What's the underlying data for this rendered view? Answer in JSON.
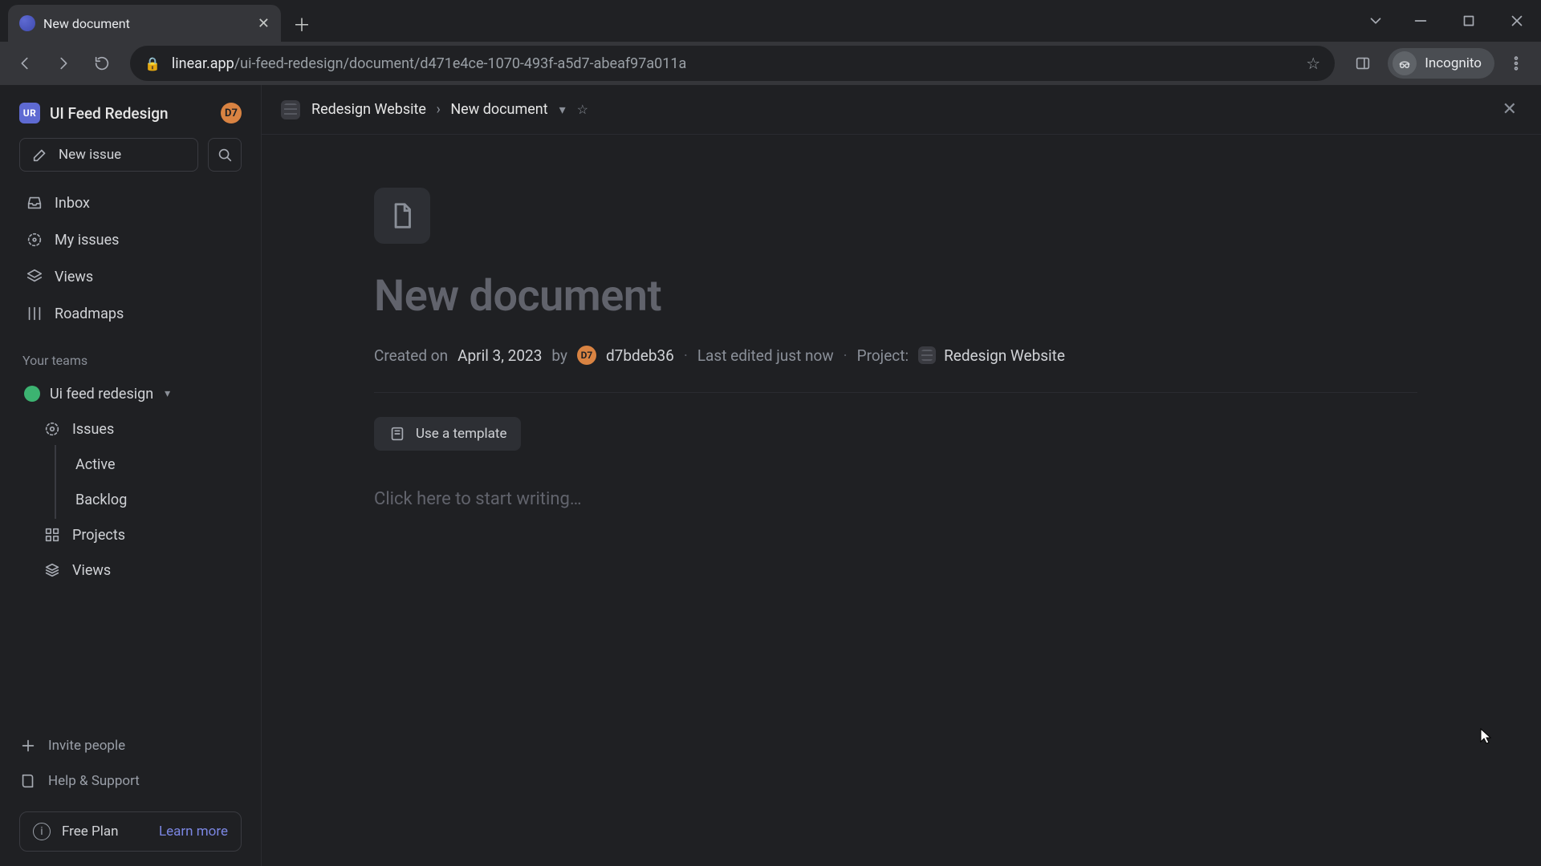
{
  "browser": {
    "tab_title": "New document",
    "url_host": "linear.app",
    "url_path": "/ui-feed-redesign/document/d471e4ce-1070-493f-a5d7-abeaf97a011a",
    "incognito_label": "Incognito"
  },
  "sidebar": {
    "workspace_initials": "UR",
    "workspace_name": "UI Feed Redesign",
    "user_initials": "D7",
    "new_issue_label": "New issue",
    "nav": {
      "inbox": "Inbox",
      "my_issues": "My issues",
      "views": "Views",
      "roadmaps": "Roadmaps"
    },
    "teams_label": "Your teams",
    "team_name": "Ui feed redesign",
    "team_children": {
      "issues": "Issues",
      "active": "Active",
      "backlog": "Backlog",
      "projects": "Projects",
      "views": "Views"
    },
    "invite_label": "Invite people",
    "help_label": "Help & Support",
    "plan_label": "Free Plan",
    "learn_more_label": "Learn more"
  },
  "header": {
    "project": "Redesign Website",
    "separator": "›",
    "doc": "New document"
  },
  "document": {
    "title_placeholder": "New document",
    "created_prefix": "Created on ",
    "created_date": "April 3, 2023",
    "created_by_word": " by ",
    "author_initials": "D7",
    "author_name": "d7bdeb36",
    "edited_label": "Last edited just now",
    "project_label": "Project:",
    "project_name": "Redesign Website",
    "template_btn": "Use a template",
    "editor_placeholder": "Click here to start writing…"
  },
  "colors": {
    "accent": "#5e6ad2",
    "author_badge": "#d98342"
  }
}
